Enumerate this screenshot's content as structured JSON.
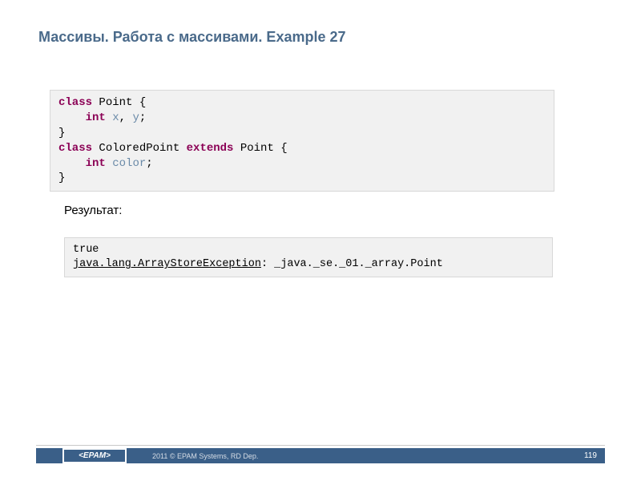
{
  "title": "Массивы. Работа с массивами. Example 27",
  "code": {
    "line1_kw": "class",
    "line1_rest": " Point {",
    "line2_indent": "    ",
    "line2_kw": "int",
    "line2_sp": " ",
    "line2_var1": "x",
    "line2_comma": ", ",
    "line2_var2": "y",
    "line2_semi": ";",
    "line3": "}",
    "line4_kw1": "class",
    "line4_mid": " ColoredPoint ",
    "line4_kw2": "extends",
    "line4_end": " Point {",
    "line5_indent": "    ",
    "line5_kw": "int",
    "line5_sp": " ",
    "line5_var": "color",
    "line5_semi": ";",
    "line6": "}"
  },
  "result_label": "Результат:",
  "output": {
    "line1": "true",
    "line2_exc": "java.lang.ArrayStoreException",
    "line2_rest": ": _java._se._01._array.Point"
  },
  "footer": {
    "logo": "<EPAM>",
    "copyright": "2011 © EPAM Systems, RD Dep.",
    "page": "119"
  }
}
